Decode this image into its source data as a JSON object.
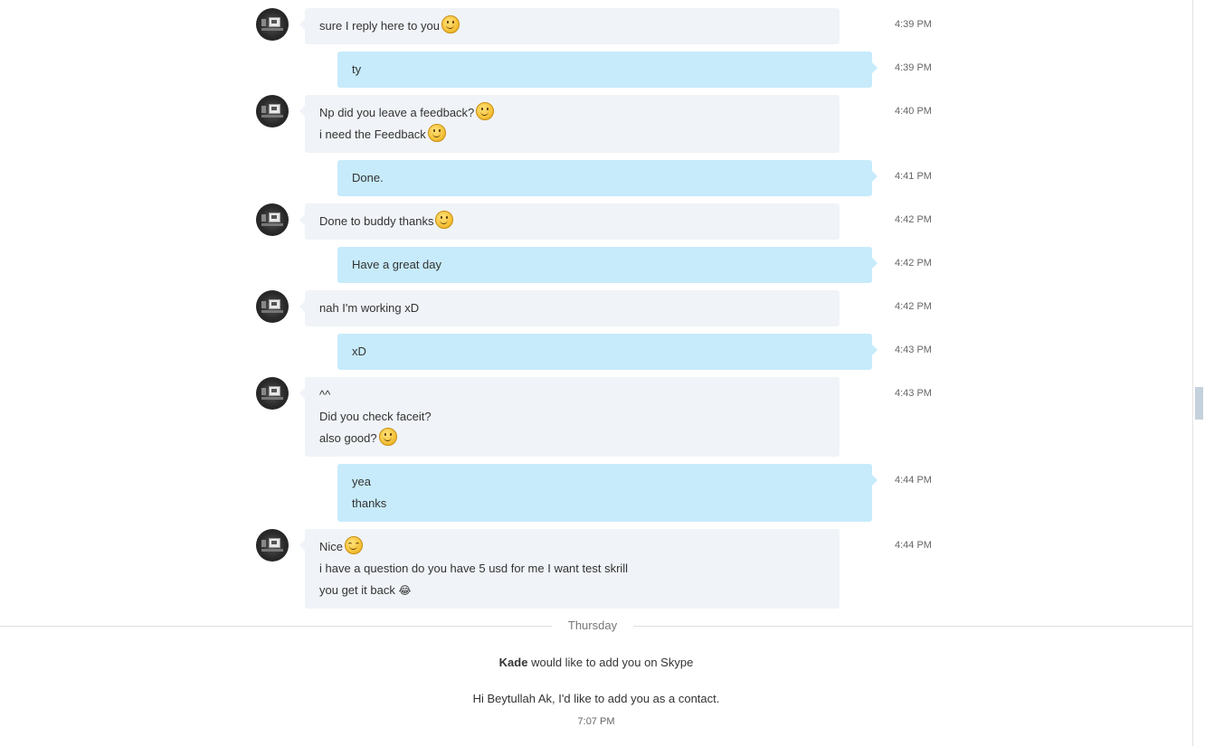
{
  "contact": {
    "name": "Kade"
  },
  "messages": [
    {
      "dir": "in",
      "time": "4:39 PM",
      "lines": [
        {
          "text": "sure I reply here to you",
          "emoji": "smile"
        }
      ]
    },
    {
      "dir": "out",
      "time": "4:39 PM",
      "lines": [
        {
          "text": "ty"
        }
      ]
    },
    {
      "dir": "in",
      "time": "4:40 PM",
      "lines": [
        {
          "text": "Np did you leave a feedback?",
          "emoji": "smile"
        },
        {
          "text": "i need the Feedback",
          "emoji": "smile"
        }
      ]
    },
    {
      "dir": "out",
      "time": "4:41 PM",
      "lines": [
        {
          "text": "Done."
        }
      ]
    },
    {
      "dir": "in",
      "time": "4:42 PM",
      "lines": [
        {
          "text": "Done to buddy thanks",
          "emoji": "smile"
        }
      ]
    },
    {
      "dir": "out",
      "time": "4:42 PM",
      "lines": [
        {
          "text": "Have a great day"
        }
      ]
    },
    {
      "dir": "in",
      "time": "4:42 PM",
      "lines": [
        {
          "text": "nah I'm working xD"
        }
      ]
    },
    {
      "dir": "out",
      "time": "4:43 PM",
      "lines": [
        {
          "text": "xD"
        }
      ]
    },
    {
      "dir": "in",
      "time": "4:43 PM",
      "lines": [
        {
          "text": "^^"
        },
        {
          "text": "Did you check faceit?"
        },
        {
          "text": "also good?",
          "emoji": "smile"
        }
      ]
    },
    {
      "dir": "out",
      "time": "4:44 PM",
      "lines": [
        {
          "text": "yea"
        },
        {
          "text": "thanks"
        }
      ]
    },
    {
      "dir": "in",
      "time": "4:44 PM",
      "lines": [
        {
          "text": "Nice",
          "emoji": "blush"
        },
        {
          "text": "i have a question do you have 5 usd for me I want test skrill"
        },
        {
          "text": "you get it back",
          "emoji": "laugh"
        }
      ]
    }
  ],
  "day_separator": "Thursday",
  "contact_request": {
    "name": "Kade",
    "text": " would like to add you on Skype",
    "greeting": "Hi Beytullah Ak, I'd like to add you as a contact.",
    "time": "7:07 PM"
  },
  "emoji_text": {
    "laugh": "😂"
  },
  "colors": {
    "incoming_bubble": "#f0f3f7",
    "outgoing_bubble": "#c7ebfb"
  }
}
